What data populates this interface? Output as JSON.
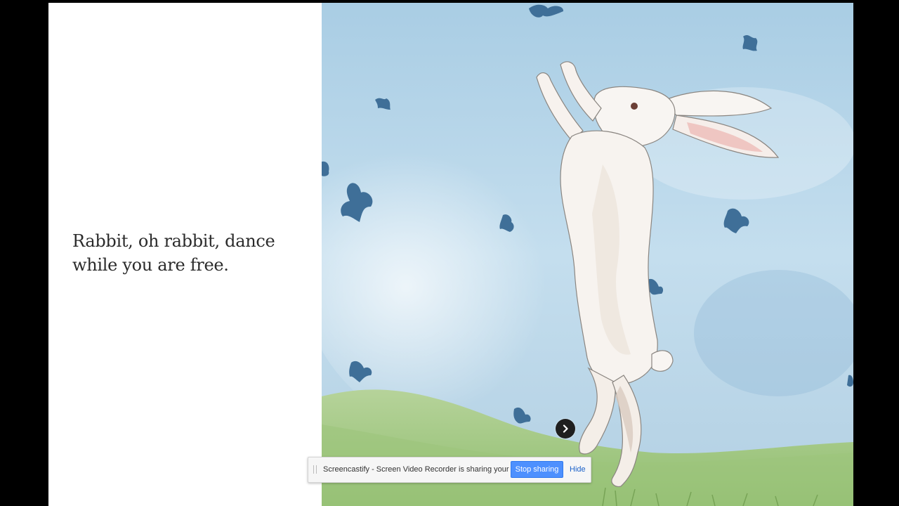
{
  "story": {
    "lines": [
      "Rabbit, oh rabbit, dance",
      "while you are free."
    ]
  },
  "illustration": {
    "subject": "watercolor-white-rabbit-dancing",
    "colors": {
      "sky": "#b9d7ea",
      "grass": "#a9c98a",
      "butterflies": "#3f6f98",
      "rabbit": "#f7f3ef"
    }
  },
  "navigation": {
    "next_icon": "chevron-right-icon"
  },
  "share_bar": {
    "message": "Screencastify - Screen Video Recorder is sharing your screen.",
    "stop_label": "Stop sharing",
    "hide_label": "Hide",
    "stop_color": "#4d90fe"
  }
}
